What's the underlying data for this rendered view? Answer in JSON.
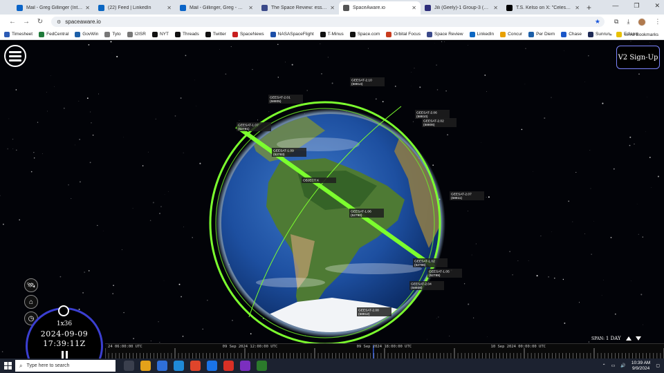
{
  "browser": {
    "tabs": [
      {
        "title": "Mail - Greg Gillinger (Integrity)",
        "color": "#0a64c8",
        "active": false
      },
      {
        "title": "(22) Feed | LinkedIn",
        "color": "#0a66c2",
        "active": false
      },
      {
        "title": "Mail - Gillinger, Greg - Outlook",
        "color": "#0a64c8",
        "active": false
      },
      {
        "title": "The Space Review: essays and c",
        "color": "#3b4a8a",
        "active": false
      },
      {
        "title": "SpaceAware.io",
        "color": "#555555",
        "active": true
      },
      {
        "title": "Jili (Geely)-1 Group-3 (10 sats)",
        "color": "#2d2d7a",
        "active": false
      },
      {
        "title": "T.S. Kelso on X: \"CelesTrak has",
        "color": "#000000",
        "active": false
      }
    ],
    "url": "spaceaware.io",
    "bookmarks": [
      {
        "label": "Timesheet",
        "color": "#2b5bb5"
      },
      {
        "label": "FedCentral",
        "color": "#1f7a3a"
      },
      {
        "label": "GovWin",
        "color": "#1c5fa8"
      },
      {
        "label": "Tyto",
        "color": "#777777"
      },
      {
        "label": "I2ISR",
        "color": "#777777"
      },
      {
        "label": "NYT",
        "color": "#111111"
      },
      {
        "label": "Threads",
        "color": "#111111"
      },
      {
        "label": "Twitter",
        "color": "#111111"
      },
      {
        "label": "SpaceNews",
        "color": "#c81e1e"
      },
      {
        "label": "NASASpaceFlight",
        "color": "#1c4fa8"
      },
      {
        "label": "T-Minus",
        "color": "#111111"
      },
      {
        "label": "Space.com",
        "color": "#111111"
      },
      {
        "label": "Orbital Focus",
        "color": "#c83c1e"
      },
      {
        "label": "Space Review",
        "color": "#3b4a8a"
      },
      {
        "label": "LinkedIn",
        "color": "#0a66c2"
      },
      {
        "label": "Concur",
        "color": "#e8a000"
      },
      {
        "label": "Per Diem",
        "color": "#1c5fa8"
      },
      {
        "label": "Chase",
        "color": "#1a56c8"
      },
      {
        "label": "Sunrun",
        "color": "#1e2a55"
      },
      {
        "label": "Edison",
        "color": "#e8c000"
      }
    ],
    "all_bookmarks": "All Bookmarks"
  },
  "app": {
    "signup_label": "V2 Sign-Up",
    "speed": "1x36",
    "date": "2024-09-09",
    "time": "17:39:11Z",
    "span_prefix": "SPAN:",
    "span_value": "1 DAY",
    "timeline_labels": [
      {
        "text": "24 06:00:00 UTC",
        "pos": 0.005
      },
      {
        "text": "09 Sep 2024 12:00:00 UTC",
        "pos": 0.21
      },
      {
        "text": "09 Sep 2024 18:00:00 UTC",
        "pos": 0.45
      },
      {
        "text": "10 Sep 2024 00:00:00 UTC",
        "pos": 0.69
      }
    ],
    "current_time_pos": 0.48
  },
  "satellites": [
    {
      "name": "GEESAT-2.10",
      "id": "58814"
    },
    {
      "name": "GEESAT-2.01",
      "id": "58805"
    },
    {
      "name": "GEESAT-2.06",
      "id": "58810"
    },
    {
      "name": "GEESAT-2.02",
      "id": "58806"
    },
    {
      "name": "GEESAT-1.07",
      "id": "52791"
    },
    {
      "name": "GEESAT-1.09",
      "id": "52793"
    },
    {
      "name": "OBJECT K",
      "id": ""
    },
    {
      "name": "GEESAT-1.06",
      "id": "52790"
    },
    {
      "name": "GEESAT-2.07",
      "id": "58811"
    },
    {
      "name": "GEESAT-1.02",
      "id": "52786"
    },
    {
      "name": "GEESAT-1.05",
      "id": "52789"
    },
    {
      "name": "GEESAT-2.04",
      "id": "58808"
    },
    {
      "name": "GEESAT-2.08",
      "id": "58812"
    }
  ],
  "taskbar": {
    "search_placeholder": "Type here to search",
    "apps": [
      "#3a3f4d",
      "#e3a21a",
      "#2f6fd8",
      "#1f8ad8",
      "#e0452b",
      "#1a73e8",
      "#d93025",
      "#7b2fbf",
      "#2b7a2b"
    ],
    "time": "10:39 AM",
    "date": "9/9/2024"
  }
}
